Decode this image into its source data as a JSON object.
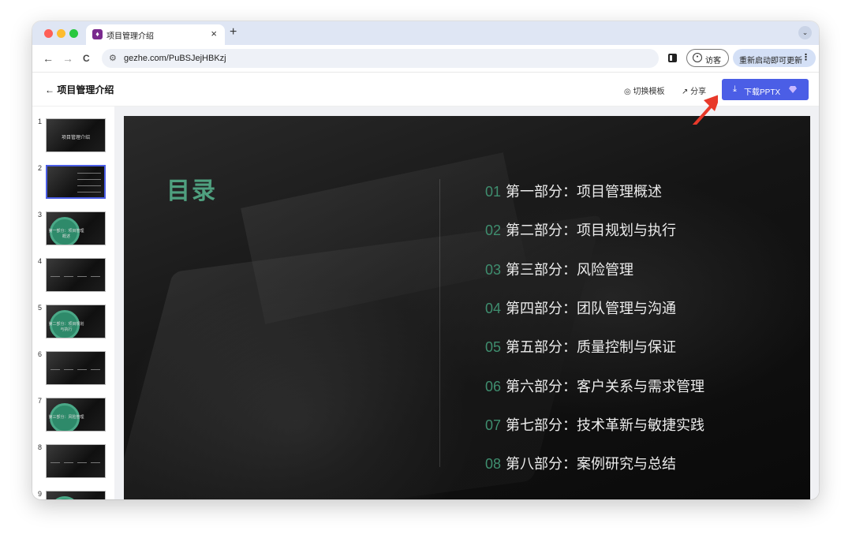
{
  "browser": {
    "tab_title": "项目管理介绍",
    "tab_close": "×",
    "new_tab": "+",
    "tab_menu": "⌄",
    "url": "gezhe.com/PuBSJejHBKzj",
    "guest_label": "访客",
    "update_label": "重新启动即可更新",
    "update_menu": "⋮",
    "nav_back": "←",
    "nav_forward": "→",
    "nav_reload": "C"
  },
  "header": {
    "title": "← 项目管理介绍",
    "switch_template": "切换模板",
    "share": "分享",
    "download": "下载PPTX",
    "accent": "#4b5ee6"
  },
  "sidebar": {
    "thumbnails": [
      {
        "num": "1",
        "text": "项目管理介绍",
        "style": "title"
      },
      {
        "num": "2",
        "text": "",
        "style": "toc"
      },
      {
        "num": "3",
        "text": "第一部分：项目管理概述",
        "style": "section"
      },
      {
        "num": "4",
        "text": "",
        "style": "content"
      },
      {
        "num": "5",
        "text": "第二部分：项目规划与执行",
        "style": "section"
      },
      {
        "num": "6",
        "text": "",
        "style": "content"
      },
      {
        "num": "7",
        "text": "第三部分：风险管理",
        "style": "section"
      },
      {
        "num": "8",
        "text": "",
        "style": "content"
      },
      {
        "num": "9",
        "text": "",
        "style": "section"
      }
    ]
  },
  "slide": {
    "title": "目录",
    "accent": "#4fa07f",
    "items": [
      {
        "num": "01",
        "label": "第一部分：项目管理概述"
      },
      {
        "num": "02",
        "label": "第二部分：项目规划与执行"
      },
      {
        "num": "03",
        "label": "第三部分：风险管理"
      },
      {
        "num": "04",
        "label": "第四部分：团队管理与沟通"
      },
      {
        "num": "05",
        "label": "第五部分：质量控制与保证"
      },
      {
        "num": "06",
        "label": "第六部分：客户关系与需求管理"
      },
      {
        "num": "07",
        "label": "第七部分：技术革新与敏捷实践"
      },
      {
        "num": "08",
        "label": "第八部分：案例研究与总结"
      }
    ]
  }
}
